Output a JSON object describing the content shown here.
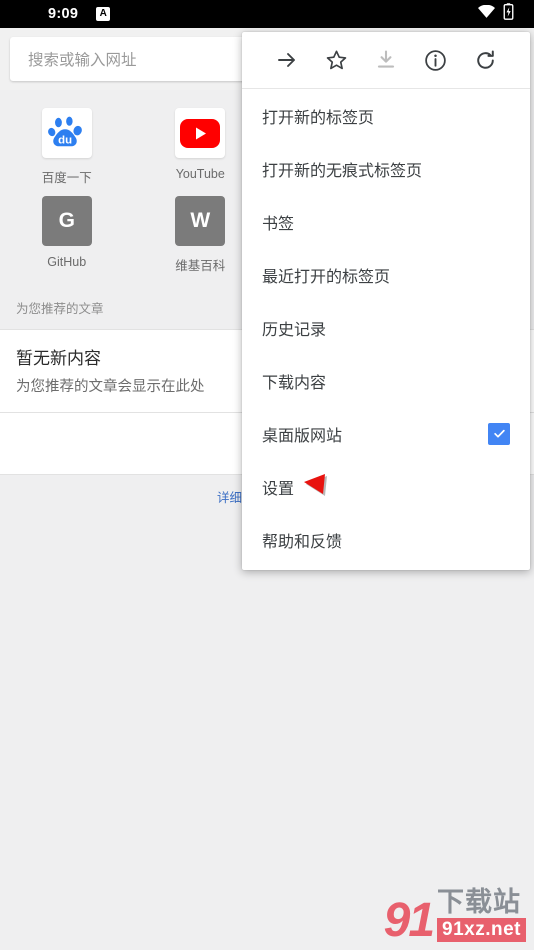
{
  "statusbar": {
    "time": "9:09",
    "app_badge": "A",
    "wifi_icon": "wifi-icon",
    "battery_icon": "battery-charging-icon"
  },
  "omnibox": {
    "placeholder": "搜索或输入网址",
    "value": ""
  },
  "tiles": [
    {
      "label": "百度一下",
      "icon": "baidu-icon",
      "style": "image"
    },
    {
      "label": "YouTube",
      "icon": "youtube-icon",
      "style": "image"
    },
    {
      "label": "",
      "icon": "",
      "style": "empty"
    },
    {
      "label": "",
      "icon": "",
      "style": "empty"
    },
    {
      "label": "GitHub",
      "icon": "G",
      "style": "letter"
    },
    {
      "label": "维基百科",
      "icon": "W",
      "style": "letter"
    },
    {
      "label": "",
      "icon": "",
      "style": "empty"
    },
    {
      "label": "",
      "icon": "",
      "style": "empty"
    }
  ],
  "feed": {
    "section_header": "为您推荐的文章",
    "empty_title": "暂无新内容",
    "empty_subtitle": "为您推荐的文章会显示在此处",
    "learn_more": "详细了解推荐内容"
  },
  "menu": {
    "toolbar_icons": [
      {
        "name": "forward-arrow-icon",
        "label": "前进",
        "disabled": false
      },
      {
        "name": "bookmark-star-icon",
        "label": "收藏",
        "disabled": false
      },
      {
        "name": "download-icon",
        "label": "下载",
        "disabled": true
      },
      {
        "name": "page-info-icon",
        "label": "网页信息",
        "disabled": false
      },
      {
        "name": "reload-icon",
        "label": "重新加载",
        "disabled": false
      }
    ],
    "items": [
      {
        "label": "打开新的标签页",
        "checkbox": false
      },
      {
        "label": "打开新的无痕式标签页",
        "checkbox": false
      },
      {
        "label": "书签",
        "checkbox": false
      },
      {
        "label": "最近打开的标签页",
        "checkbox": false
      },
      {
        "label": "历史记录",
        "checkbox": false
      },
      {
        "label": "下载内容",
        "checkbox": false
      },
      {
        "label": "桌面版网站",
        "checkbox": true,
        "checked": true
      },
      {
        "label": "设置",
        "checkbox": false
      },
      {
        "label": "帮助和反馈",
        "checkbox": false
      }
    ]
  },
  "annotation": {
    "type": "red-arrow",
    "color": "#e8130f",
    "points_at": "设置"
  },
  "watermark": {
    "logo": "91",
    "name": "下载站",
    "url": "91xz.net"
  },
  "colors": {
    "accent_blue": "#4285f4",
    "link_blue": "#3b6ec4",
    "annotation_red": "#e8130f",
    "page_bg": "#efeff0",
    "menu_bg": "#ffffff"
  }
}
